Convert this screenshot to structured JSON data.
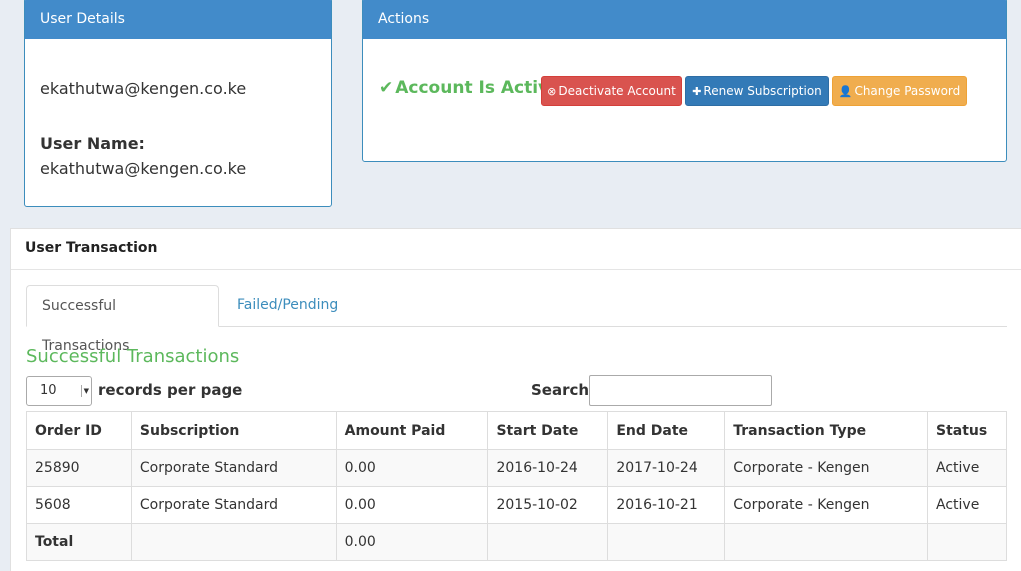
{
  "user_details": {
    "heading": "User Details",
    "email": "ekathutwa@kengen.co.ke",
    "username_label": "User Name:",
    "username": "ekathutwa@kengen.co.ke"
  },
  "actions": {
    "heading": "Actions",
    "status_text": "Account Is Active",
    "deactivate_label": "Deactivate Account",
    "renew_label": "Renew Subscription",
    "change_password_label": "Change Password"
  },
  "transactions": {
    "section_title": "User Transaction",
    "tabs": [
      {
        "label": "Successful Transactions",
        "active": true
      },
      {
        "label": "Failed/Pending",
        "active": false
      }
    ],
    "subtitle": "Successful Transactions",
    "page_length": "10",
    "records_per_page_label": "records per page",
    "search_label": "Search:",
    "search_value": "",
    "columns": [
      "Order ID",
      "Subscription",
      "Amount Paid",
      "Start Date",
      "End Date",
      "Transaction Type",
      "Status"
    ],
    "rows": [
      [
        "25890",
        "Corporate Standard",
        "0.00",
        "2016-10-24",
        "2017-10-24",
        "Corporate - Kengen",
        "Active"
      ],
      [
        "5608",
        "Corporate Standard",
        "0.00",
        "2015-10-02",
        "2016-10-21",
        "Corporate - Kengen",
        "Active"
      ]
    ],
    "footer": {
      "label": "Total",
      "amount": "0.00"
    }
  },
  "colors": {
    "panel_heading": "#428bca",
    "success_green": "#5cb85c",
    "danger_red": "#d9534f",
    "primary_blue": "#337ab7",
    "warning_orange": "#f0ad4e",
    "link_blue": "#3c8dbc"
  },
  "icons": {
    "status": "check-icon",
    "deactivate": "times-circle-icon",
    "renew": "plus-icon",
    "change_password": "user-icon",
    "select": "caret-down-icon"
  }
}
